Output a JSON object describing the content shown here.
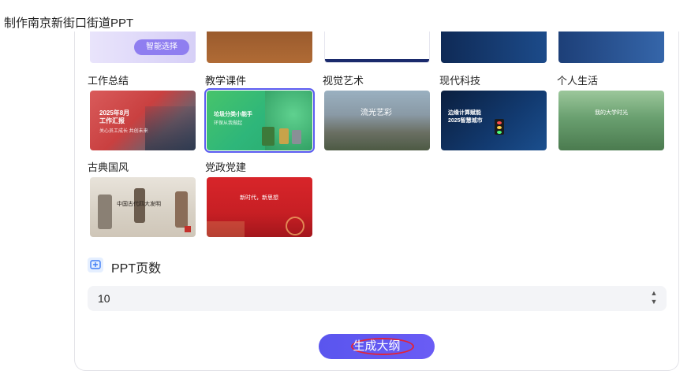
{
  "page": {
    "title": "制作南京新街口街道PPT"
  },
  "top_thumbs": [
    {
      "kind": "smart",
      "label": "智能选择"
    },
    {
      "kind": "wood"
    },
    {
      "kind": "doc"
    },
    {
      "kind": "tech"
    },
    {
      "kind": "city"
    }
  ],
  "categories": [
    {
      "label": "工作总结"
    },
    {
      "label": "教学课件"
    },
    {
      "label": "视觉艺术"
    },
    {
      "label": "现代科技"
    },
    {
      "label": "个人生活"
    },
    {
      "label": "古典国风"
    },
    {
      "label": "党政党建"
    }
  ],
  "templates": [
    {
      "title": "2025年8月\n工作汇报",
      "sub": "关心员工成长 共创未来"
    },
    {
      "title": "垃圾分类小能手",
      "sub": "环保从我做起"
    },
    {
      "title": "流光艺彩",
      "sub": ""
    },
    {
      "title": "边缘计算赋能\n2025智慧城市",
      "sub": ""
    },
    {
      "title": "我的大学时光",
      "sub": ""
    },
    {
      "title": "中国古代四大发明",
      "sub": ""
    },
    {
      "title": "新时代，新思想",
      "sub": ""
    }
  ],
  "pages": {
    "label": "PPT页数",
    "value": "10",
    "icon": "slides-plus-icon"
  },
  "generate": {
    "label": "生成大纲"
  },
  "colors": {
    "accent": "#5b5cf0",
    "highlight": "#e0243a"
  }
}
